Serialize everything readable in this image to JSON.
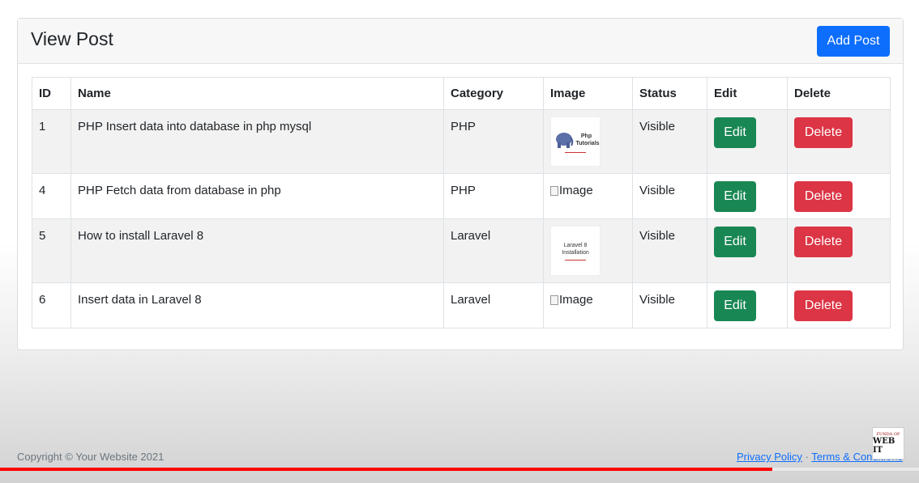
{
  "header": {
    "title": "View Post",
    "add_button": "Add Post"
  },
  "table": {
    "columns": [
      "ID",
      "Name",
      "Category",
      "Image",
      "Status",
      "Edit",
      "Delete"
    ],
    "rows": [
      {
        "id": "1",
        "name": "PHP Insert data into database in php mysql",
        "category": "PHP",
        "image": {
          "type": "thumb-php",
          "text": "Php Tutorials"
        },
        "status": "Visible",
        "edit": "Edit",
        "delete": "Delete"
      },
      {
        "id": "4",
        "name": "PHP Fetch data from database in php",
        "category": "PHP",
        "image": {
          "type": "broken",
          "alt": "Image"
        },
        "status": "Visible",
        "edit": "Edit",
        "delete": "Delete"
      },
      {
        "id": "5",
        "name": "How to install Laravel 8",
        "category": "Laravel",
        "image": {
          "type": "thumb-text",
          "text": "Laravel 8 Installation"
        },
        "status": "Visible",
        "edit": "Edit",
        "delete": "Delete"
      },
      {
        "id": "6",
        "name": "Insert data in Laravel 8",
        "category": "Laravel",
        "image": {
          "type": "broken",
          "alt": "Image"
        },
        "status": "Visible",
        "edit": "Edit",
        "delete": "Delete"
      }
    ]
  },
  "footer": {
    "copyright": "Copyright © Your Website 2021",
    "privacy": "Privacy Policy",
    "separator": "·",
    "terms": "Terms & Conditions"
  },
  "badge": {
    "small": "FUNDA OF",
    "big": "WEB IT"
  },
  "video_progress": 0.84,
  "colors": {
    "primary": "#0d6efd",
    "success": "#198754",
    "danger": "#dc3545",
    "progress": "#ff0000"
  }
}
